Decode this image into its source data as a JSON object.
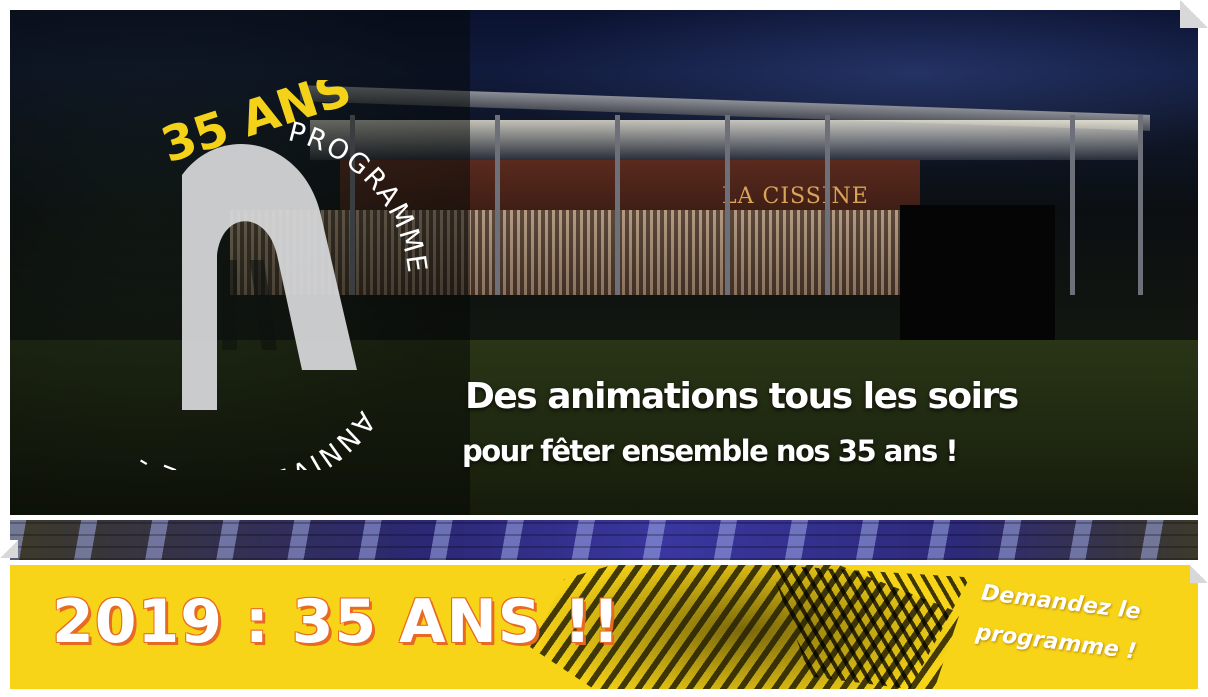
{
  "hero": {
    "venue_sign": "LA CISSINE",
    "logo": {
      "years_label": "35 ANS",
      "arc_text_program": "PROGRAMME",
      "arc_text_anniversary": "ANNIVERSAIRE -"
    },
    "headline": "Des animations tous les soirs",
    "subheadline": "pour fêter ensemble nos 35 ans !"
  },
  "banner": {
    "title": "2019 : 35 ANS !!",
    "cta_line1": "Demandez le",
    "cta_line2": "programme !"
  },
  "colors": {
    "banner_yellow": "#f7d417",
    "logo_yellow": "#f5d21a",
    "title_outline_orange": "#e86a22"
  }
}
